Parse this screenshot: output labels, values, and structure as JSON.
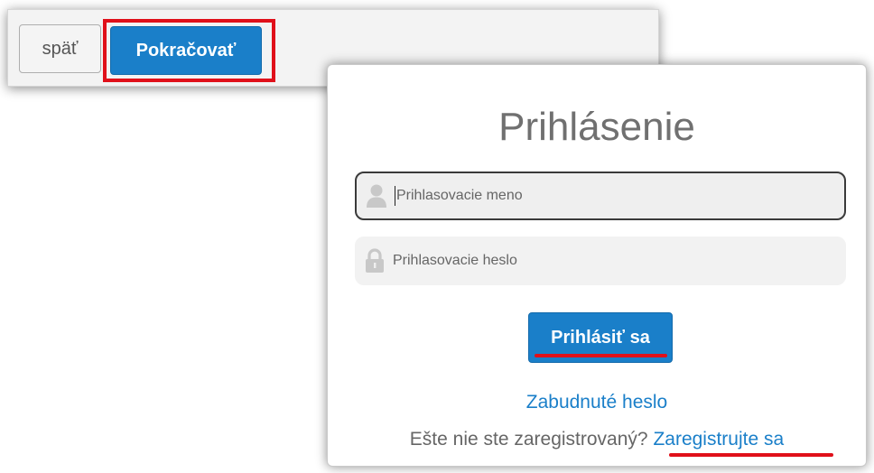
{
  "toolbar": {
    "back_label": "späť",
    "continue_label": "Pokračovať"
  },
  "login": {
    "title": "Prihlásenie",
    "username": {
      "placeholder": "Prihlasovacie meno",
      "icon": "user-icon",
      "value": ""
    },
    "password": {
      "placeholder": "Prihlasovacie heslo",
      "icon": "lock-icon",
      "value": ""
    },
    "submit_label": "Prihlásiť sa",
    "forgot_label": "Zabudnuté heslo",
    "not_registered_text": "Ešte nie ste zaregistrovaný?",
    "register_label": "Zaregistrujte sa"
  },
  "colors": {
    "primary": "#1a7fc9",
    "highlight": "#e0101a",
    "title": "#707070"
  }
}
